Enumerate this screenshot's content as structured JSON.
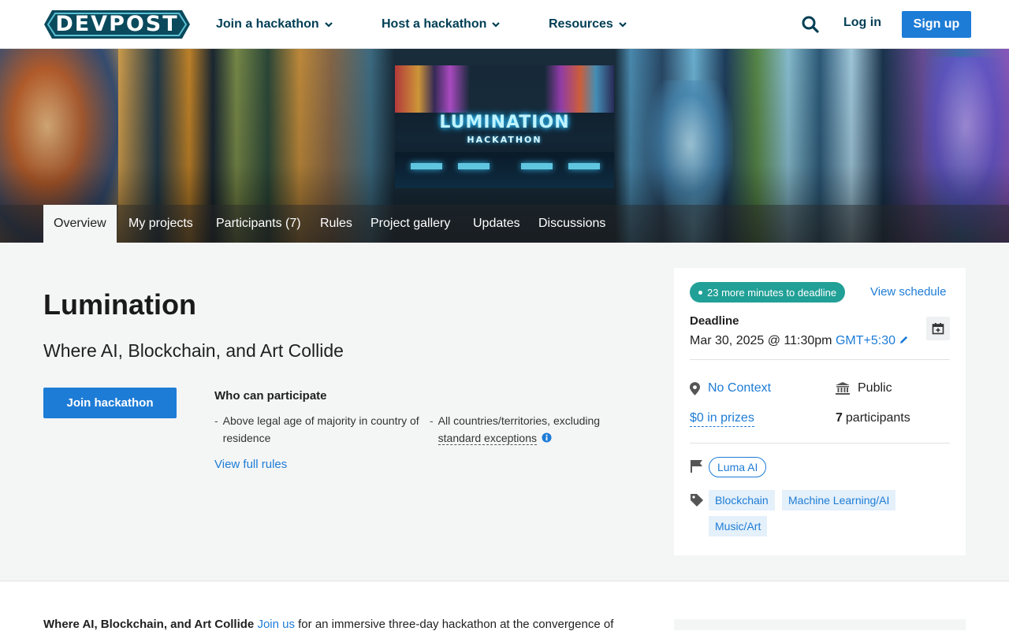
{
  "header": {
    "logo_text": "DEVPOST",
    "nav": [
      {
        "label": "Join a hackathon",
        "icon": "chevron-down-icon"
      },
      {
        "label": "Host a hackathon",
        "icon": "chevron-down-icon"
      },
      {
        "label": "Resources",
        "icon": "chevron-down-icon"
      }
    ],
    "search_icon": "search-icon",
    "login_label": "Log in",
    "signup_label": "Sign up"
  },
  "banner": {
    "logo_title": "LUMINATION",
    "logo_subtitle": "HACKATHON"
  },
  "tabs": [
    {
      "label": "Overview",
      "active": true
    },
    {
      "label": "My projects"
    },
    {
      "label": "Participants (7)"
    },
    {
      "label": "Rules"
    },
    {
      "label": "Project gallery"
    },
    {
      "label": "Updates"
    },
    {
      "label": "Discussions"
    }
  ],
  "overview": {
    "title": "Lumination",
    "tagline": "Where AI, Blockchain, and Art Collide",
    "join_button": "Join hackathon",
    "who_title": "Who can participate",
    "criteria": [
      {
        "text": "Above legal age of majority in country of residence"
      },
      {
        "text_prefix": "All countries/territories, excluding",
        "link": "standard exceptions"
      }
    ],
    "full_rules_link": "View full rules"
  },
  "sidebar": {
    "countdown": "23 more minutes to deadline",
    "view_schedule": "View schedule",
    "deadline_label": "Deadline",
    "deadline_date": "Mar 30, 2025 @ 11:30pm",
    "timezone": "GMT+5:30",
    "location": "No Context",
    "visibility": "Public",
    "prizes": "$0 in prizes",
    "participants_count": "7",
    "participants_label": "participants",
    "managed_by": "Luma AI",
    "themes": [
      "Blockchain",
      "Machine Learning/AI",
      "Music/Art"
    ]
  },
  "description": {
    "bold_lead": "Where AI, Blockchain, and Art Collide",
    "link": "Join us",
    "rest": "for an immersive three-day hackathon at the convergence of"
  },
  "colors": {
    "brand_dark": "#003e54",
    "brand_logo": "#0a4a5c",
    "accent_blue": "#1d7cd6",
    "countdown_teal": "#21a097",
    "section_bg": "#f4f5f5"
  }
}
